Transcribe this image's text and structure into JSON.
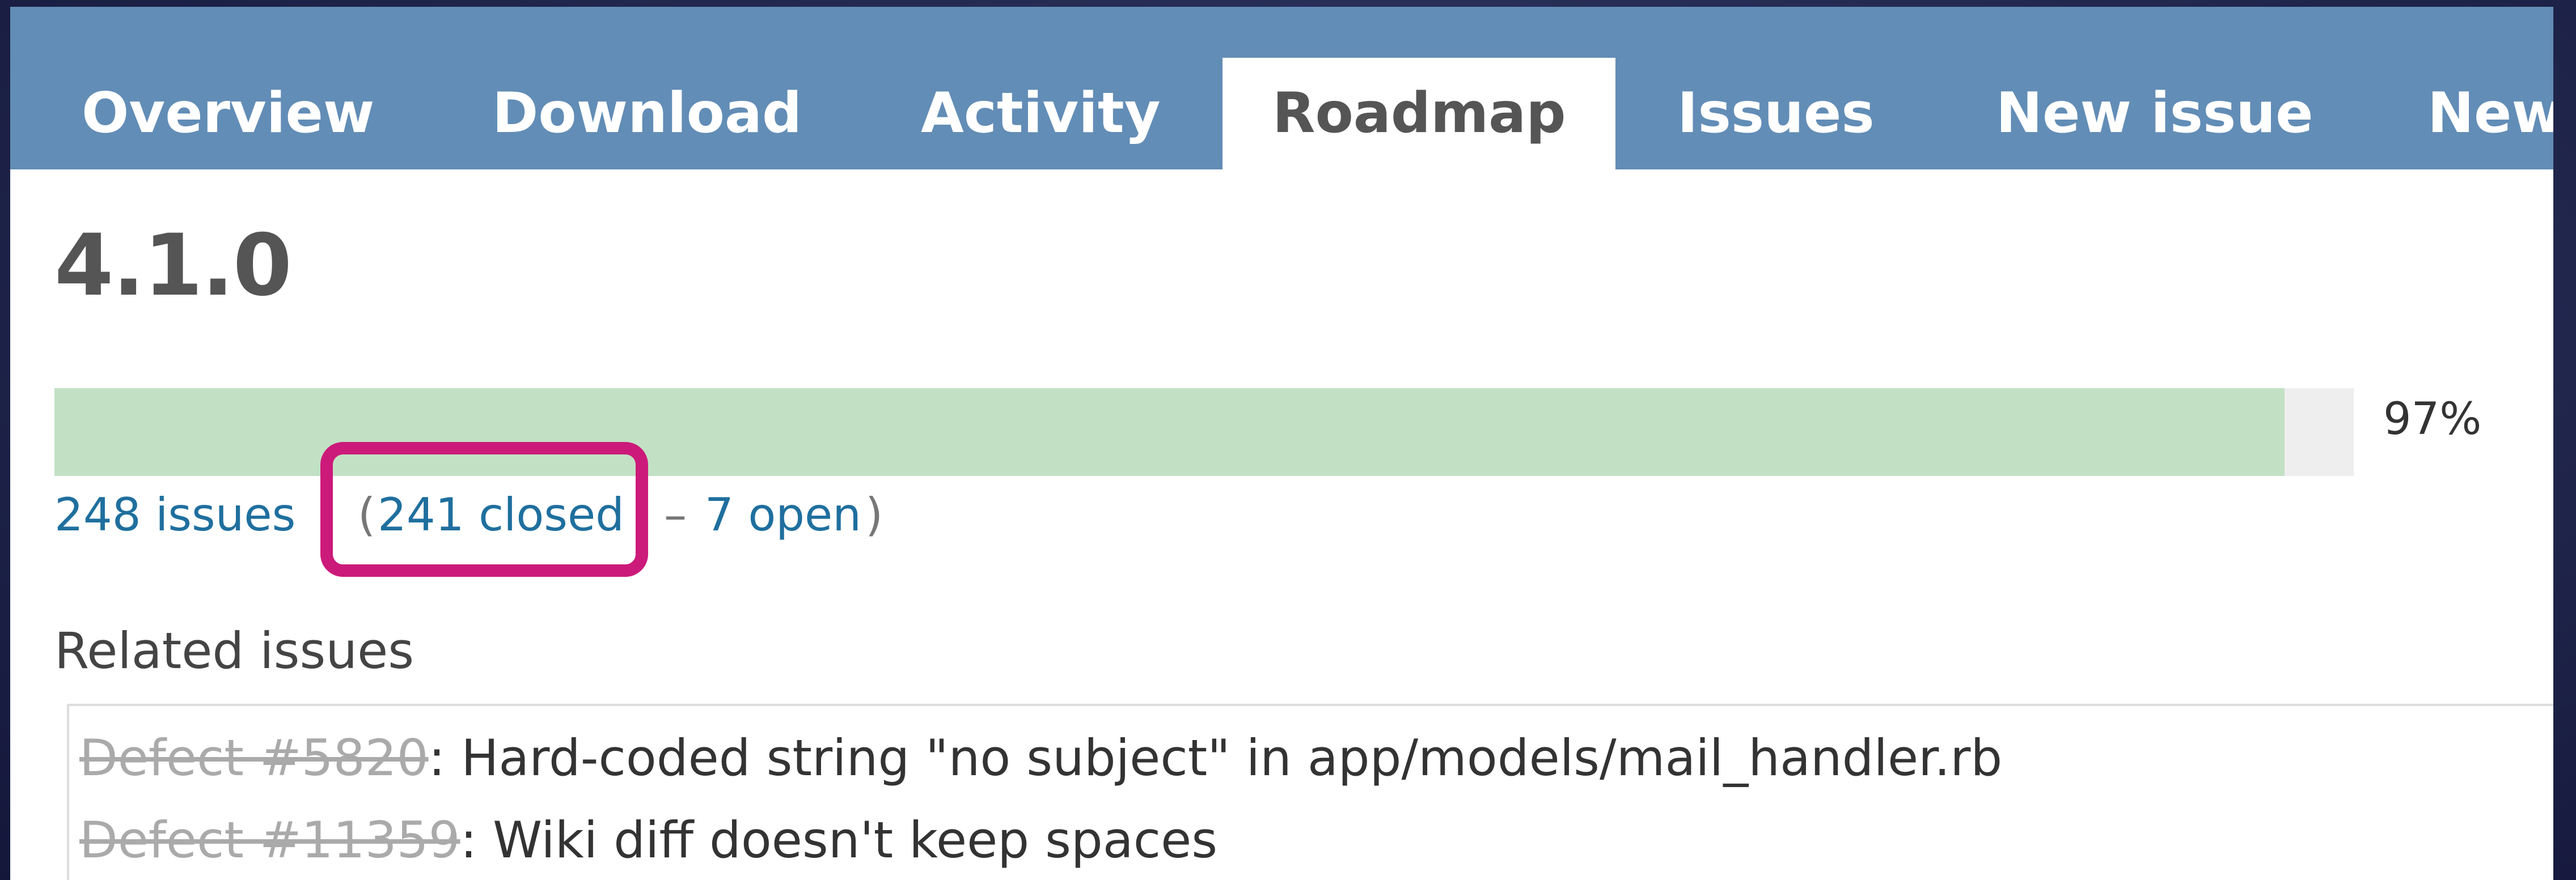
{
  "tabs": {
    "overview": "Overview",
    "download": "Download",
    "activity": "Activity",
    "roadmap": "Roadmap",
    "issues": "Issues",
    "new_issue": "New issue",
    "news_partial": "New"
  },
  "active_tab": "Roadmap",
  "version": {
    "title": "4.1.0",
    "progress_percent": 97,
    "progress_label": "97%",
    "issues_total": "248 issues",
    "paren_open": "(",
    "issues_closed": "241 closed",
    "dash": "–",
    "issues_open": "7 open",
    "paren_close": ")"
  },
  "related": {
    "title": "Related issues",
    "items": [
      {
        "link": "Defect #5820",
        "text": ": Hard-coded string \"no subject\" in app/models/mail_handler.rb"
      },
      {
        "link": "Defect #11359",
        "text": ": Wiki diff doesn't keep spaces"
      }
    ]
  },
  "colors": {
    "tab_bar": "#628db6",
    "progress_fill": "#c2e1c4",
    "link": "#1f6f9e",
    "highlight": "#cc1a7a"
  }
}
